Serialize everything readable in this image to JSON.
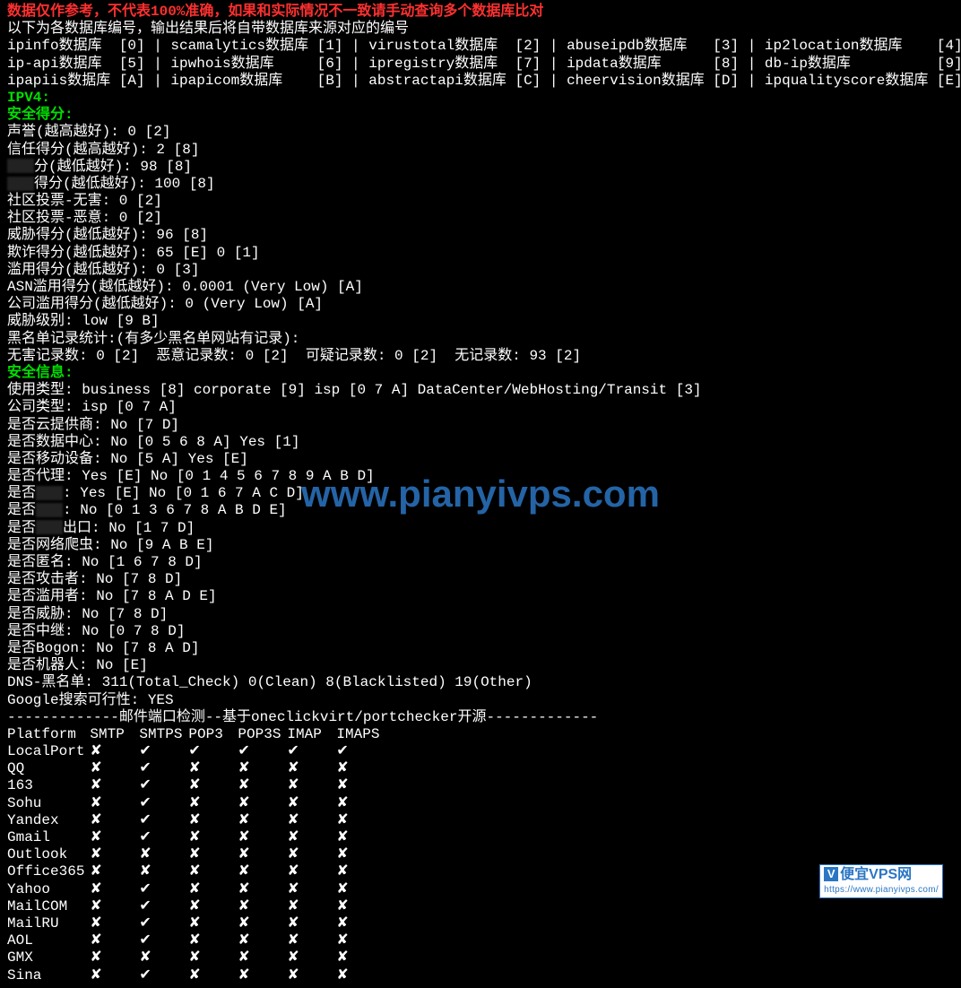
{
  "warning": "数据仅作参考，不代表100%准确，如果和实际情况不一致请手动查询多个数据库比对",
  "db_intro": "以下为各数据库编号，输出结果后将自带数据库来源对应的编号",
  "db_row1": "ipinfo数据库  [0] | scamalytics数据库 [1] | virustotal数据库  [2] | abuseipdb数据库   [3] | ip2location数据库    [4]",
  "db_row2": "ip-api数据库  [5] | ipwhois数据库     [6] | ipregistry数据库  [7] | ipdata数据库      [8] | db-ip数据库          [9]",
  "db_row3": "ipapiis数据库 [A] | ipapicom数据库    [B] | abstractapi数据库 [C] | cheervision数据库 [D] | ipqualityscore数据库 [E]",
  "ipv4_label": "IPV4:",
  "sec_score_label": "安全得分:",
  "sec_lines": [
    "声誉(越高越好): 0 [2]",
    "信任得分(越高越好): 2 [8]"
  ],
  "obscured_a_suffix": "分(越低越好): 98 [8]",
  "obscured_b_suffix": "得分(越低越好): 100 [8]",
  "sec_lines2": [
    "社区投票-无害: 0 [2]",
    "社区投票-恶意: 0 [2]",
    "威胁得分(越低越好): 96 [8]",
    "欺诈得分(越低越好): 65 [E] 0 [1]",
    "滥用得分(越低越好): 0 [3]",
    "ASN滥用得分(越低越好): 0.0001 (Very Low) [A]",
    "公司滥用得分(越低越好): 0 (Very Low) [A]",
    "威胁级别: low [9 B]",
    "黑名单记录统计:(有多少黑名单网站有记录):",
    "无害记录数: 0 [2]  恶意记录数: 0 [2]  可疑记录数: 0 [2]  无记录数: 93 [2]"
  ],
  "sec_info_label": "安全信息:",
  "info_lines1": [
    "使用类型: business [8] corporate [9] isp [0 7 A] DataCenter/WebHosting/Transit [3]",
    "公司类型: isp [0 7 A]",
    "是否云提供商: No [7 D]",
    "是否数据中心: No [0 5 6 8 A] Yes [1]",
    "是否移动设备: No [5 A] Yes [E]",
    "是否代理: Yes [E] No [0 1 4 5 6 7 8 9 A B D]"
  ],
  "obscured_c_prefix": "是否",
  "obscured_c_suffix": ": Yes [E] No [0 1 6 7 A C D]",
  "obscured_d_prefix": "是否",
  "obscured_d_suffix": ": No [0 1 3 6 7 8 A B D E]",
  "obscured_e_prefix": "是否",
  "obscured_e_suffix": "出口: No [1 7 D]",
  "info_lines2": [
    "是否网络爬虫: No [9 A B E]",
    "是否匿名: No [1 6 7 8 D]",
    "是否攻击者: No [7 8 D]",
    "是否滥用者: No [7 8 A D E]",
    "是否威胁: No [7 8 D]",
    "是否中继: No [0 7 8 D]",
    "是否Bogon: No [7 8 A D]",
    "是否机器人: No [E]",
    "DNS-黑名单: 311(Total_Check) 0(Clean) 8(Blacklisted) 19(Other)",
    "Google搜索可行性: YES"
  ],
  "port_title": "-------------邮件端口检测--基于oneclickvirt/portchecker开源-------------",
  "port_header": [
    "Platform",
    "SMTP",
    "SMTPS",
    "POP3",
    "POP3S",
    "IMAP",
    "IMAPS"
  ],
  "port_rows": [
    {
      "name": "LocalPort",
      "cells": [
        "✘",
        "✔",
        "✔",
        "✔",
        "✔",
        "✔"
      ]
    },
    {
      "name": "QQ",
      "cells": [
        "✘",
        "✔",
        "✘",
        "✘",
        "✘",
        "✘"
      ]
    },
    {
      "name": "163",
      "cells": [
        "✘",
        "✔",
        "✘",
        "✘",
        "✘",
        "✘"
      ]
    },
    {
      "name": "Sohu",
      "cells": [
        "✘",
        "✔",
        "✘",
        "✘",
        "✘",
        "✘"
      ]
    },
    {
      "name": "Yandex",
      "cells": [
        "✘",
        "✔",
        "✘",
        "✘",
        "✘",
        "✘"
      ]
    },
    {
      "name": "Gmail",
      "cells": [
        "✘",
        "✔",
        "✘",
        "✘",
        "✘",
        "✘"
      ]
    },
    {
      "name": "Outlook",
      "cells": [
        "✘",
        "✘",
        "✘",
        "✘",
        "✘",
        "✘"
      ]
    },
    {
      "name": "Office365",
      "cells": [
        "✘",
        "✘",
        "✘",
        "✘",
        "✘",
        "✘"
      ]
    },
    {
      "name": "Yahoo",
      "cells": [
        "✘",
        "✔",
        "✘",
        "✘",
        "✘",
        "✘"
      ]
    },
    {
      "name": "MailCOM",
      "cells": [
        "✘",
        "✔",
        "✘",
        "✘",
        "✘",
        "✘"
      ]
    },
    {
      "name": "MailRU",
      "cells": [
        "✘",
        "✔",
        "✘",
        "✘",
        "✘",
        "✘"
      ]
    },
    {
      "name": "AOL",
      "cells": [
        "✘",
        "✔",
        "✘",
        "✘",
        "✘",
        "✘"
      ]
    },
    {
      "name": "GMX",
      "cells": [
        "✘",
        "✘",
        "✘",
        "✘",
        "✘",
        "✘"
      ]
    },
    {
      "name": "Sina",
      "cells": [
        "✘",
        "✔",
        "✘",
        "✘",
        "✘",
        "✘"
      ]
    }
  ],
  "watermark": "www.pianyivps.com",
  "badge_title": "便宜VPS网",
  "badge_url": "https://www.pianyivps.com/"
}
